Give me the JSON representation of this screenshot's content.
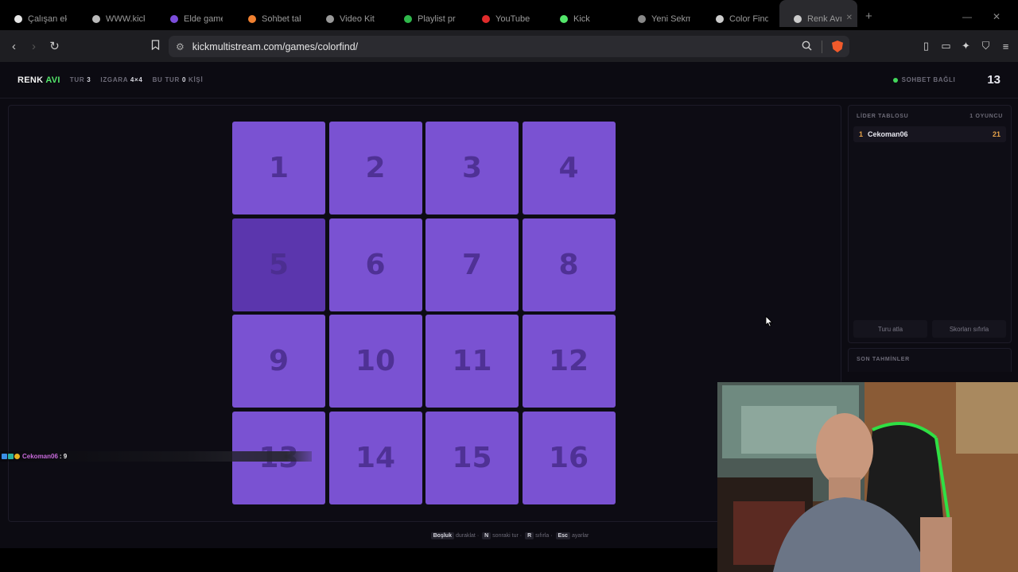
{
  "browser": {
    "tabs": [
      {
        "label": "Çalışan ekran",
        "color": "#e6e6e6"
      },
      {
        "label": "WWW.kick...",
        "color": "#bbbbbb"
      },
      {
        "label": "Elde game",
        "color": "#7b4ddb"
      },
      {
        "label": "Sohbet tab",
        "color": "#f08030"
      },
      {
        "label": "Video Kit",
        "color": "#999999"
      },
      {
        "label": "Playlist pr",
        "color": "#2fb84b"
      },
      {
        "label": "YouTube",
        "color": "#e02b2b"
      },
      {
        "label": "Kick",
        "color": "#53e66a"
      },
      {
        "label": "Yeni Sekme",
        "color": "#888888"
      },
      {
        "label": "Color Find",
        "color": "#cccccc"
      },
      {
        "label": "Renk Avı",
        "color": "#cccccc"
      }
    ],
    "url": "kickmultistream.com/games/colorfind/"
  },
  "header": {
    "logo_part1": "RENK",
    "logo_part2": "AVI",
    "round_label": "TUR",
    "round_value": "3",
    "grid_label": "IZGARA",
    "grid_value": "4×4",
    "this_round_label": "BU TUR",
    "this_round_value": "0",
    "this_round_suffix": "KİŞİ",
    "connection": "SOHBET BAĞLI",
    "countdown": "13"
  },
  "board": {
    "cells": [
      {
        "n": "1",
        "color": "#7a52d2"
      },
      {
        "n": "2",
        "color": "#7a52d2"
      },
      {
        "n": "3",
        "color": "#7a52d2"
      },
      {
        "n": "4",
        "color": "#7a52d2"
      },
      {
        "n": "5",
        "color": "#5b36ad"
      },
      {
        "n": "6",
        "color": "#7a52d2"
      },
      {
        "n": "7",
        "color": "#7a52d2"
      },
      {
        "n": "8",
        "color": "#7a52d2"
      },
      {
        "n": "9",
        "color": "#7a52d2"
      },
      {
        "n": "10",
        "color": "#7a52d2"
      },
      {
        "n": "11",
        "color": "#7a52d2"
      },
      {
        "n": "12",
        "color": "#7a52d2"
      },
      {
        "n": "13",
        "color": "#7a52d2"
      },
      {
        "n": "14",
        "color": "#7a52d2"
      },
      {
        "n": "15",
        "color": "#7a52d2"
      },
      {
        "n": "16",
        "color": "#7a52d2"
      }
    ]
  },
  "leaderboard": {
    "title": "LİDER TABLOSU",
    "count": "1 OYUNCU",
    "rows": [
      {
        "rank": "1",
        "name": "Cekoman06",
        "score": "21"
      }
    ],
    "skip_button": "Turu atla",
    "reset_button": "Skorları sıfırla"
  },
  "guesses": {
    "title": "SON TAHMİNLER"
  },
  "chat": {
    "user": "Cekoman06",
    "message": ": 9"
  },
  "hints": [
    {
      "key": "Boşluk",
      "desc": "duraklat ·"
    },
    {
      "key": "N",
      "desc": "sonraki tur ·"
    },
    {
      "key": "R",
      "desc": "sıfırla ·"
    },
    {
      "key": "Esc",
      "desc": "ayarlar"
    }
  ]
}
